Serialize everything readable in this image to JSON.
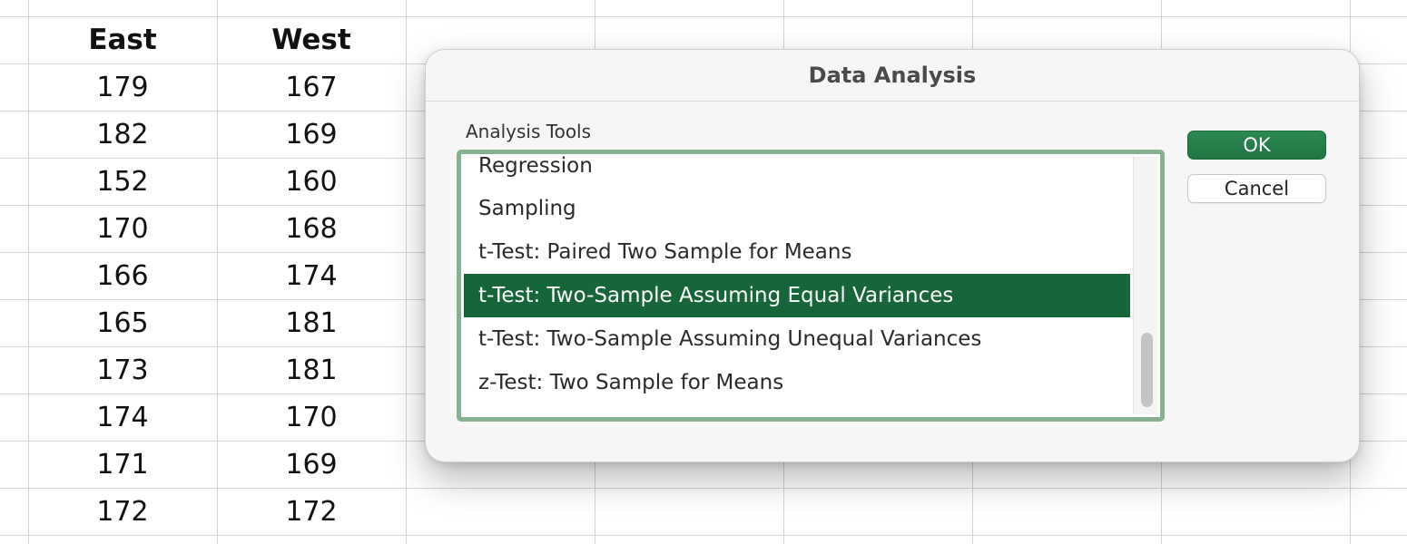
{
  "spreadsheet": {
    "columns": [
      {
        "header": "East",
        "values": [
          "179",
          "182",
          "152",
          "170",
          "166",
          "165",
          "173",
          "174",
          "171",
          "172"
        ]
      },
      {
        "header": "West",
        "values": [
          "167",
          "169",
          "160",
          "168",
          "174",
          "181",
          "181",
          "170",
          "169",
          "172"
        ]
      }
    ]
  },
  "dialog": {
    "title": "Data Analysis",
    "tools_label": "Analysis Tools",
    "tools": [
      "Regression",
      "Sampling",
      "t-Test: Paired Two Sample for Means",
      "t-Test: Two-Sample Assuming Equal Variances",
      "t-Test: Two-Sample Assuming Unequal Variances",
      "z-Test: Two Sample for Means"
    ],
    "selected_tool": "t-Test: Two-Sample Assuming Equal Variances",
    "ok_label": "OK",
    "cancel_label": "Cancel"
  },
  "colors": {
    "selection": "#17663a",
    "list_border": "#86b291",
    "ok_button": "#1f7342"
  }
}
